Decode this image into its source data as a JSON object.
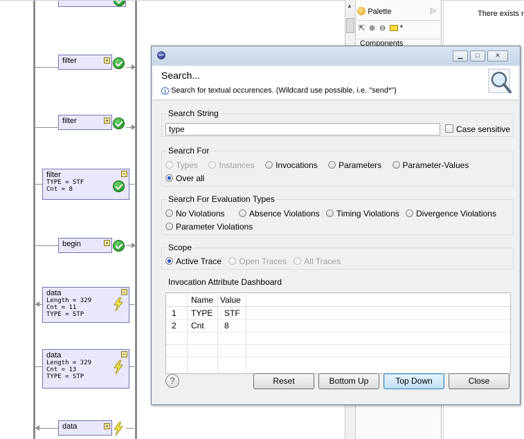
{
  "diagram": {
    "nodes": [
      {
        "title": "filter",
        "attrs": [],
        "status": "ok"
      },
      {
        "title": "filter",
        "attrs": [],
        "status": "ok"
      },
      {
        "title": "filter",
        "attrs": [
          "TYPE = STF",
          "Cnt = 8"
        ],
        "status": "ok"
      },
      {
        "title": "begin",
        "attrs": [],
        "status": "ok"
      },
      {
        "title": "data",
        "attrs": [
          "Length = 329",
          "Cnt = 11",
          "TYPE = STP"
        ],
        "status": "violation"
      },
      {
        "title": "data",
        "attrs": [
          "Length = 329",
          "Cnt = 13",
          "TYPE = STP"
        ],
        "status": "violation"
      },
      {
        "title": "data",
        "attrs": [],
        "status": "violation"
      }
    ]
  },
  "side": {
    "palette_label": "Palette",
    "components_label": "Components",
    "right_text": "There exists n"
  },
  "dialog": {
    "title": "Search...",
    "description": "Search for textual occurences. (Wildcard use possible, i.e. \"send*\")",
    "search_string": {
      "label": "Search String",
      "value": "type",
      "case_sensitive_label": "Case sensitive",
      "case_sensitive": false
    },
    "search_for": {
      "label": "Search For",
      "options": [
        {
          "label": "Types",
          "enabled": false,
          "selected": false
        },
        {
          "label": "Instances",
          "enabled": false,
          "selected": false
        },
        {
          "label": "Invocations",
          "enabled": true,
          "selected": false
        },
        {
          "label": "Parameters",
          "enabled": true,
          "selected": false
        },
        {
          "label": "Parameter-Values",
          "enabled": true,
          "selected": false
        },
        {
          "label": "Over all",
          "enabled": true,
          "selected": true
        }
      ]
    },
    "eval_types": {
      "label": "Search For Evaluation Types",
      "options": [
        {
          "label": "No Violations",
          "selected": false
        },
        {
          "label": "Absence Violations",
          "selected": false
        },
        {
          "label": "Timing Violations",
          "selected": false
        },
        {
          "label": "Divergence Violations",
          "selected": false
        },
        {
          "label": "Parameter Violations",
          "selected": false
        }
      ]
    },
    "scope": {
      "label": "Scope",
      "options": [
        {
          "label": "Active Trace",
          "enabled": true,
          "selected": true
        },
        {
          "label": "Open Traces",
          "enabled": false,
          "selected": false
        },
        {
          "label": "All Traces",
          "enabled": false,
          "selected": false
        }
      ]
    },
    "dashboard": {
      "label": "Invocation Attribute Dashboard",
      "columns": [
        "",
        "Name",
        "Value"
      ],
      "rows": [
        [
          "1",
          "TYPE",
          "STF"
        ],
        [
          "2",
          "Cnt",
          "8"
        ]
      ]
    },
    "buttons": {
      "reset": "Reset",
      "bottom_up": "Bottom Up",
      "top_down": "Top Down",
      "close": "Close"
    }
  }
}
